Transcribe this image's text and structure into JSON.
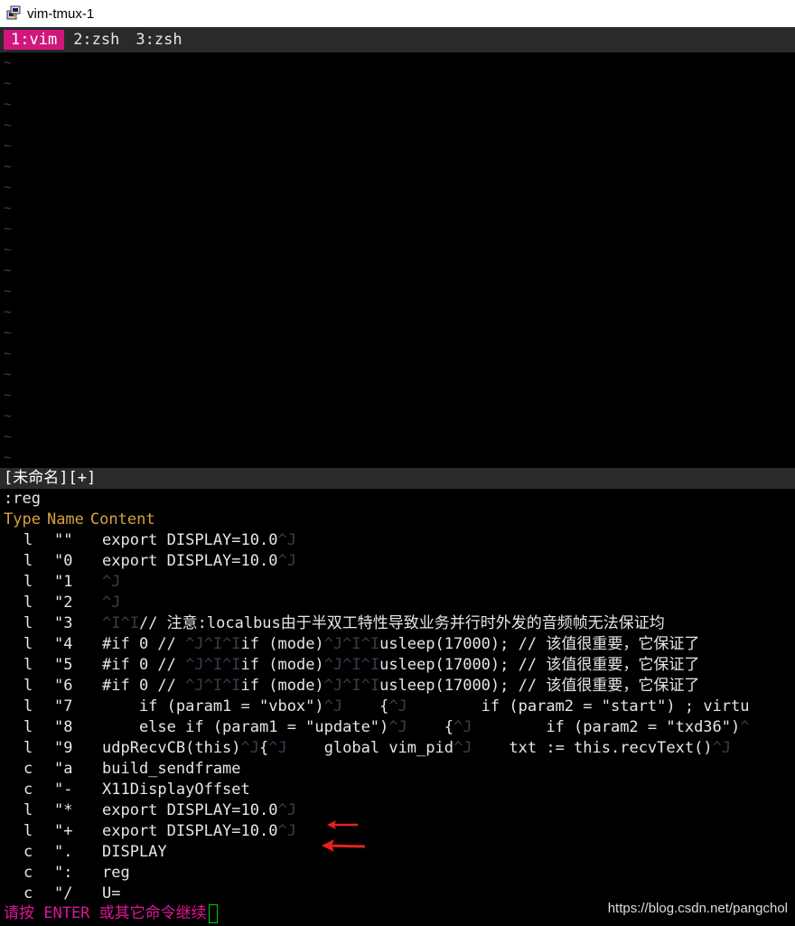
{
  "window": {
    "title": "vim-tmux-1",
    "icon": "putty-icon"
  },
  "tmux": {
    "tabs": [
      {
        "label": "1:vim",
        "active": true
      },
      {
        "label": "2:zsh",
        "active": false
      },
      {
        "label": "3:zsh",
        "active": false
      }
    ]
  },
  "vim": {
    "empty_line_marker": "~",
    "statusline": "[未命名][+]",
    "command": ":reg",
    "header": {
      "type": "Type",
      "name": "Name",
      "content": "Content"
    },
    "registers": [
      {
        "type": "l",
        "name": "\"\"",
        "content": "export DISPLAY=10.0",
        "ctl": "^J"
      },
      {
        "type": "l",
        "name": "\"0",
        "content": "export DISPLAY=10.0",
        "ctl": "^J"
      },
      {
        "type": "l",
        "name": "\"1",
        "content": "",
        "ctl": "^J"
      },
      {
        "type": "l",
        "name": "\"2",
        "content": "",
        "ctl": "^J"
      },
      {
        "type": "l",
        "name": "\"3",
        "pre": "^I^I",
        "content": "// 注意:localbus由于半双工特性导致业务并行时外发的音频帧无法保证均",
        "ctl": ""
      },
      {
        "type": "l",
        "name": "\"4",
        "content": "#if 0 // ",
        "mid": "^J^I^I",
        "content2": "if (mode)",
        "mid2": "^J^I^I",
        "content3": "usleep(17000); // 该值很重要，它保证了",
        "ctl": ""
      },
      {
        "type": "l",
        "name": "\"5",
        "content": "#if 0 // ",
        "mid": "^J^I^I",
        "content2": "if (mode)",
        "mid2": "^J^I^I",
        "content3": "usleep(17000); // 该值很重要，它保证了",
        "ctl": ""
      },
      {
        "type": "l",
        "name": "\"6",
        "content": "#if 0 // ",
        "mid": "^J^I^I",
        "content2": "if (mode)",
        "mid2": "^J^I^I",
        "content3": "usleep(17000); // 该值很重要，它保证了",
        "ctl": ""
      },
      {
        "type": "l",
        "name": "\"7",
        "content": "    if (param1 = \"vbox\")",
        "mid": "^J",
        "content2": "    {",
        "mid2": "^J",
        "content3": "        if (param2 = \"start\") ; virtu",
        "ctl": ""
      },
      {
        "type": "l",
        "name": "\"8",
        "content": "    else if (param1 = \"update\")",
        "mid": "^J",
        "content2": "    {",
        "mid2": "^J",
        "content3": "        if (param2 = \"txd36\")",
        "ctl": "^"
      },
      {
        "type": "l",
        "name": "\"9",
        "content": "udpRecvCB(this)",
        "mid": "^J",
        "content2": "{",
        "mid2": "^J",
        "content3": "    global vim_pid",
        "mid3": "^J",
        "content4": "    txt := this.recvText()",
        "ctl": "^J"
      },
      {
        "type": "c",
        "name": "\"a",
        "content": "build_sendframe",
        "ctl": ""
      },
      {
        "type": "c",
        "name": "\"-",
        "content": "X11DisplayOffset",
        "ctl": ""
      },
      {
        "type": "l",
        "name": "\"*",
        "content": "export DISPLAY=10.0",
        "ctl": "^J"
      },
      {
        "type": "l",
        "name": "\"+",
        "content": "export DISPLAY=10.0",
        "ctl": "^J"
      },
      {
        "type": "c",
        "name": "\".",
        "content": "DISPLAY",
        "ctl": ""
      },
      {
        "type": "c",
        "name": "\":",
        "content": "reg",
        "ctl": ""
      },
      {
        "type": "c",
        "name": "\"/",
        "content": "U=",
        "ctl": ""
      }
    ],
    "prompt": "请按 ENTER 或其它命令继续"
  },
  "annotations": {
    "arrow_color": "#e8211d",
    "arrow_rows": [
      "\"*",
      "\"+"
    ]
  },
  "watermark": "https://blog.csdn.net/pangchol",
  "colors": {
    "tab_active": "#d0177c",
    "header": "#d7a23a",
    "prompt": "#e0159a",
    "cursor": "#00d000",
    "control_char": "#3b3b4f"
  }
}
